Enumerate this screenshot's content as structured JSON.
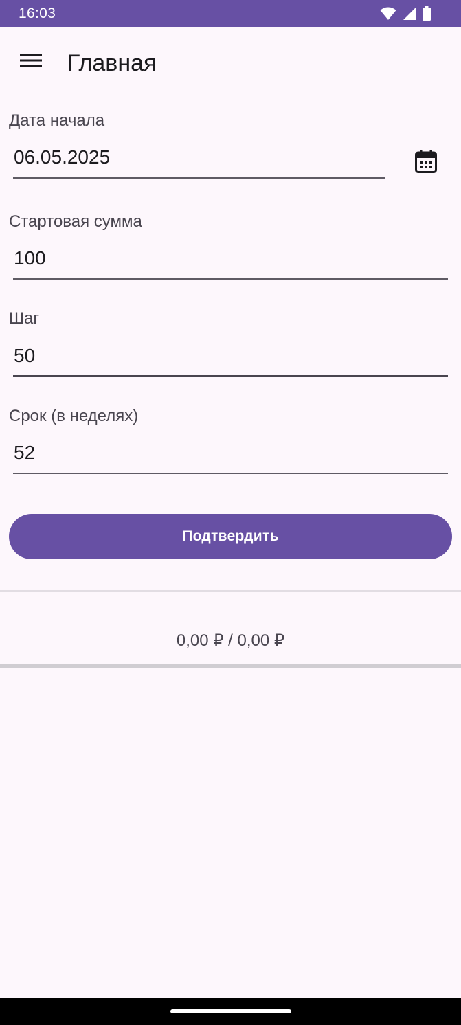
{
  "status_bar": {
    "time": "16:03",
    "icons": [
      "wifi-icon",
      "cellular-signal-icon",
      "battery-icon"
    ]
  },
  "app_bar": {
    "menu_icon": "hamburger-menu-icon",
    "title": "Главная"
  },
  "form": {
    "start_date": {
      "label": "Дата начала",
      "value": "06.05.2025",
      "icon": "calendar-icon"
    },
    "start_amount": {
      "label": "Стартовая сумма",
      "value": "100"
    },
    "step": {
      "label": "Шаг",
      "value": "50"
    },
    "term": {
      "label": "Срок (в неделях)",
      "value": "52"
    },
    "confirm_label": "Подтвердить"
  },
  "summary": {
    "text": "0,00 ₽ / 0,00 ₽",
    "progress": 0
  },
  "colors": {
    "primary": "#6750a4",
    "background": "#fdf7fc",
    "on_primary": "#ffffff"
  }
}
